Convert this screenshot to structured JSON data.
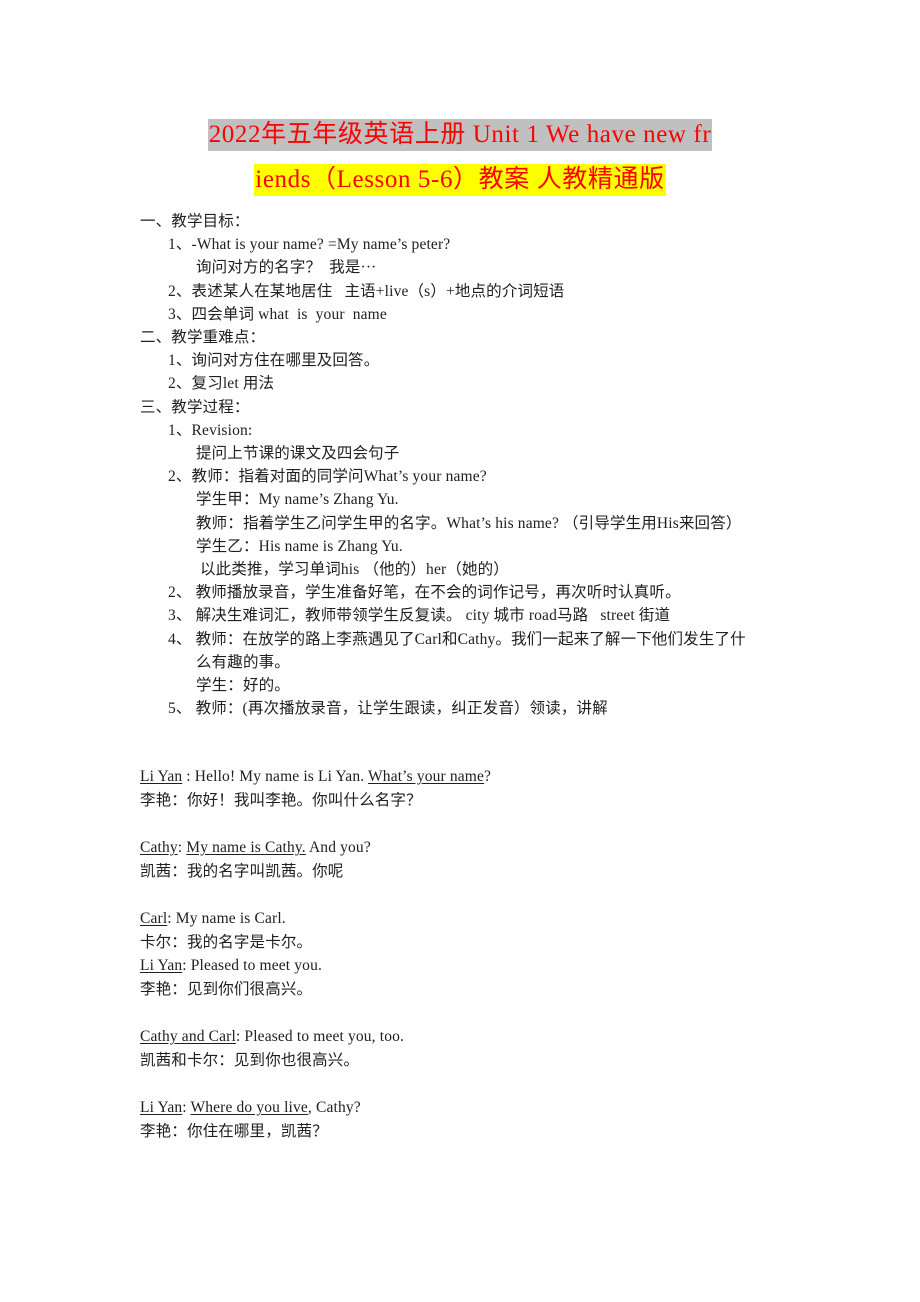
{
  "document": {
    "title": {
      "line1": "2022年五年级英语上册 Unit 1 We have new fr",
      "line2": "iends（Lesson 5-6）教案 人教精通版",
      "line1_highlight_color": "#c0c0c0",
      "line2_highlight_color": "#ffff00",
      "text_color": "#ff0000"
    },
    "sections": [
      {
        "heading": "一、教学目标：",
        "items": [
          "1、-What is your name? =My name’s peter?",
          "询问对方的名字？  我是···",
          "2、表述某人在某地居住   主语+live（s）+地点的介词短语",
          "3、四会单词 what  is  your  name"
        ]
      },
      {
        "heading": "二、教学重难点：",
        "items": [
          "1、询问对方住在哪里及回答。",
          "2、复习let 用法"
        ]
      },
      {
        "heading": "三、教学过程：",
        "items": [
          "1、Revision:",
          "提问上节课的课文及四会句子",
          "2、教师：指着对面的同学问What’s your name?",
          "学生甲：My name’s Zhang Yu.",
          "教师：指着学生乙问学生甲的名字。What’s his name? （引导学生用His来回答）",
          "学生乙：His name is Zhang Yu.",
          " 以此类推，学习单词his （他的）her（她的）",
          "2、 教师播放录音，学生准备好笔，在不会的词作记号，再次听时认真听。",
          "3、 解决生难词汇，教师带领学生反复读。 city 城市 road马路   street 街道",
          "4、 教师：在放学的路上李燕遇见了Carl和Cathy。我们一起来了解一下他们发生了什",
          "么有趣的事。",
          "学生：好的。",
          "5、 教师：(再次播放录音，让学生跟读，纠正发音）领读，讲解"
        ]
      }
    ],
    "dialogue": [
      {
        "speaker_en": "Li Yan",
        "speaker_underlined": true,
        "en_plain_before": " : Hello! My name is Li Yan. ",
        "en_underlined": "What’s your name",
        "en_plain_after": "?",
        "cn": "李艳：你好！我叫李艳。你叫什么名字？"
      },
      {
        "speaker_en": "Cathy",
        "speaker_underlined": true,
        "en_plain_before": ": ",
        "en_underlined": "My name is Cathy.",
        "en_plain_after": " And you?",
        "cn": "凯茜：我的名字叫凯茜。你呢"
      },
      {
        "speaker_en": "Carl",
        "speaker_underlined": true,
        "en_plain_before": ": My name is Carl.",
        "en_underlined": "",
        "en_plain_after": "",
        "cn": "卡尔：我的名字是卡尔。"
      },
      {
        "speaker_en": "Li Yan",
        "speaker_underlined": true,
        "en_plain_before": ": Pleased to meet you.",
        "en_underlined": "",
        "en_plain_after": "",
        "cn": "李艳：见到你们很高兴。"
      },
      {
        "speaker_en": "Cathy and Carl",
        "speaker_underlined": true,
        "en_plain_before": ": Pleased to meet you, too.",
        "en_underlined": "",
        "en_plain_after": "",
        "cn": "凯茜和卡尔：见到你也很高兴。"
      },
      {
        "speaker_en": "Li Yan",
        "speaker_underlined": true,
        "en_plain_before": ": ",
        "en_underlined": "Where do you live",
        "en_plain_after": ", Cathy?",
        "cn": "李艳：你住在哪里，凯茜？"
      }
    ]
  }
}
